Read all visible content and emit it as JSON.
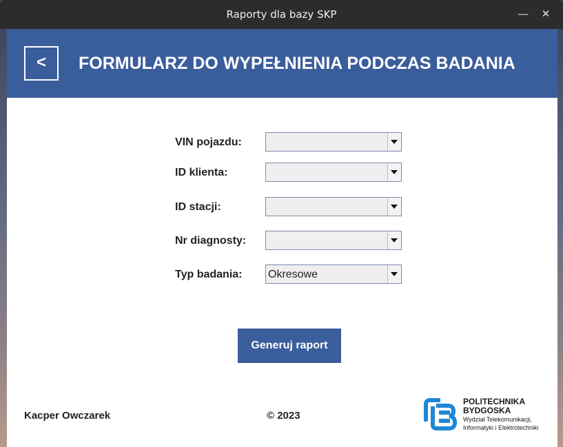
{
  "window": {
    "title": "Raporty dla bazy SKP",
    "minimize_glyph": "—",
    "close_glyph": "✕"
  },
  "header": {
    "back_label": "<",
    "title": "FORMULARZ DO WYPEŁNIENIA PODCZAS BADANIA"
  },
  "form": {
    "fields": [
      {
        "label": "VIN pojazdu:",
        "value": ""
      },
      {
        "label": "ID klienta:",
        "value": ""
      },
      {
        "label": "ID stacji:",
        "value": ""
      },
      {
        "label": "Nr diagnosty:",
        "value": ""
      },
      {
        "label": "Typ badania:",
        "value": "Okresowe"
      }
    ],
    "submit_label": "Generuj raport"
  },
  "footer": {
    "author": "Kacper Owczarek",
    "copyright": "© 2023",
    "logo": {
      "name_line1": "POLITECHNIKA",
      "name_line2": "BYDGOSKA",
      "sub_line1": "Wydział Telekomunikacji,",
      "sub_line2": "Informatyki i Elektrotechniki",
      "color": "#1e88d6"
    }
  },
  "colors": {
    "accent": "#3a5d9c",
    "titlebar": "#2c2c2c"
  }
}
